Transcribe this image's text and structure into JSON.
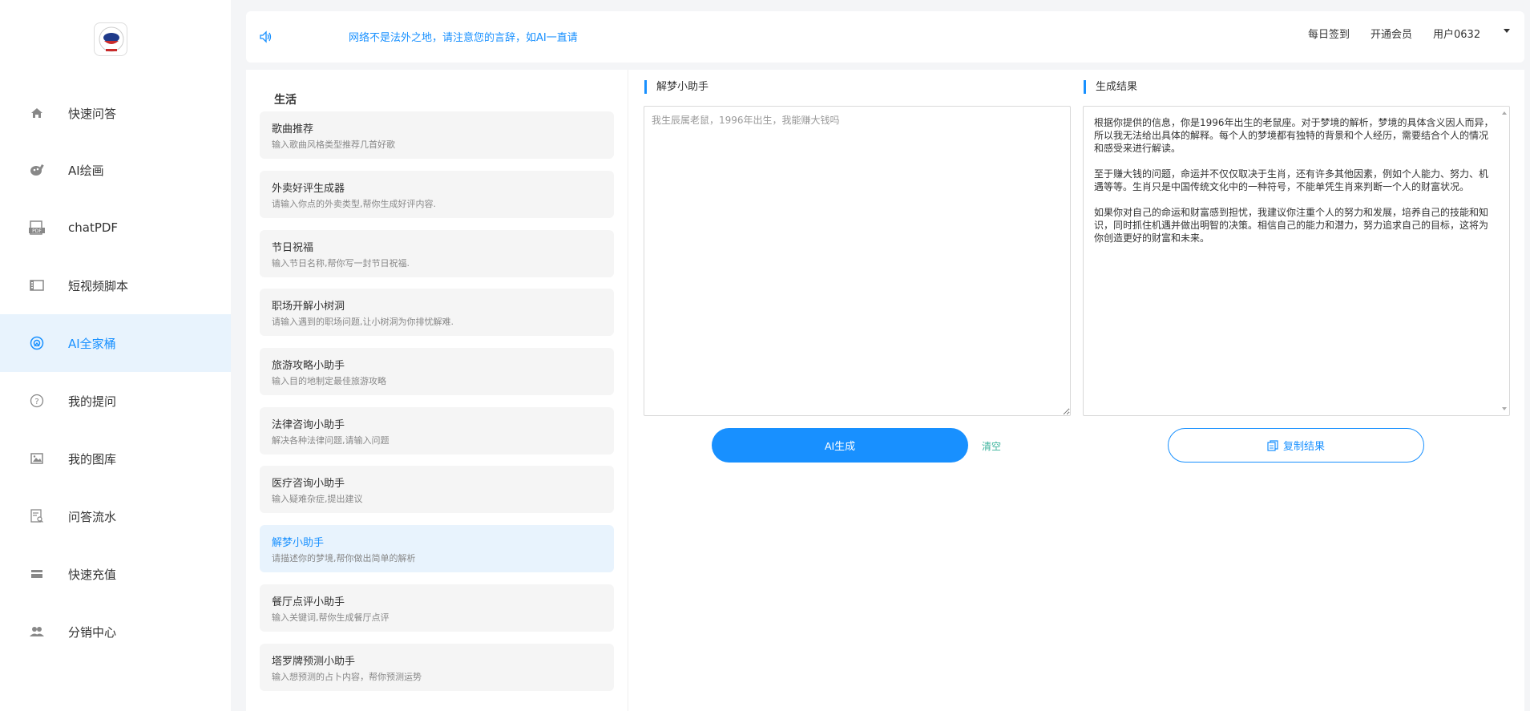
{
  "sidebar": {
    "items": [
      {
        "label": "快速问答",
        "icon": "home-icon"
      },
      {
        "label": "AI绘画",
        "icon": "paint-icon"
      },
      {
        "label": "chatPDF",
        "icon": "pdf-icon"
      },
      {
        "label": "短视频脚本",
        "icon": "film-icon"
      },
      {
        "label": "AI全家桶",
        "icon": "toolkit-icon",
        "active": true
      },
      {
        "label": "我的提问",
        "icon": "question-icon"
      },
      {
        "label": "我的图库",
        "icon": "gallery-icon"
      },
      {
        "label": "问答流水",
        "icon": "history-icon"
      },
      {
        "label": "快速充值",
        "icon": "card-icon"
      },
      {
        "label": "分销中心",
        "icon": "users-icon"
      }
    ]
  },
  "header": {
    "notice": "网络不是法外之地，请注意您的言辞，如AI一直请",
    "checkin": "每日签到",
    "vip": "开通会员",
    "user": "用户0632"
  },
  "tools": {
    "section": "生活",
    "items": [
      {
        "title": "歌曲推荐",
        "desc": "输入歌曲风格类型推荐几首好歌"
      },
      {
        "title": "外卖好评生成器",
        "desc": "请输入你点的外卖类型,帮你生成好评内容."
      },
      {
        "title": "节日祝福",
        "desc": "输入节日名称,帮你写一封节日祝福."
      },
      {
        "title": "职场开解小树洞",
        "desc": "请输入遇到的职场问题,让小树洞为你排忧解难."
      },
      {
        "title": "旅游攻略小助手",
        "desc": "输入目的地制定最佳旅游攻略"
      },
      {
        "title": "法律咨询小助手",
        "desc": "解决各种法律问题,请输入问题"
      },
      {
        "title": "医疗咨询小助手",
        "desc": "输入疑难杂症,提出建议"
      },
      {
        "title": "解梦小助手",
        "desc": "请描述你的梦境,帮你做出简单的解析",
        "active": true
      },
      {
        "title": "餐厅点评小助手",
        "desc": "输入关键词,帮你生成餐厅点评"
      },
      {
        "title": "塔罗牌预测小助手",
        "desc": "输入想预测的占卜内容，帮你预测运势"
      }
    ]
  },
  "input_panel": {
    "title": "解梦小助手",
    "value": "我生辰属老鼠，1996年出生，我能赚大钱吗"
  },
  "result_panel": {
    "title": "生成结果",
    "text": "根据你提供的信息，你是1996年出生的老鼠座。对于梦境的解析，梦境的具体含义因人而异，所以我无法给出具体的解释。每个人的梦境都有独特的背景和个人经历，需要结合个人的情况和感受来进行解读。\n\n至于赚大钱的问题，命运并不仅仅取决于生肖，还有许多其他因素，例如个人能力、努力、机遇等等。生肖只是中国传统文化中的一种符号，不能单凭生肖来判断一个人的财富状况。\n\n如果你对自己的命运和财富感到担忧，我建议你注重个人的努力和发展，培养自己的技能和知识，同时抓住机遇并做出明智的决策。相信自己的能力和潜力，努力追求自己的目标，这将为你创造更好的财富和未来。"
  },
  "actions": {
    "generate": "AI生成",
    "clear": "清空",
    "copy": "复制结果"
  },
  "colors": {
    "accent": "#1890ff",
    "clear": "#3bb39c",
    "active_bg": "#e8f3fd"
  }
}
